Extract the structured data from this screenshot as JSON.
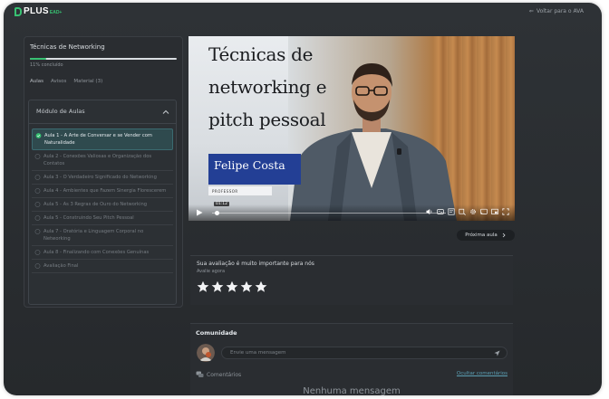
{
  "brand": {
    "name": "PLUS",
    "suffix": "EAD+"
  },
  "header": {
    "back_label": "Voltar para o AVA"
  },
  "sidebar": {
    "course_title": "Técnicas de Networking",
    "progress_percent": 11,
    "progress_label": "11% concluído",
    "tabs": [
      {
        "label": "Aulas",
        "active": true
      },
      {
        "label": "Avisos",
        "active": false
      },
      {
        "label": "Material (3)",
        "active": false
      }
    ],
    "module_title": "Módulo de Aulas",
    "lessons": [
      {
        "label": "Aula 1 - A Arte de Conversar e se Vender com Naturalidade",
        "active": true
      },
      {
        "label": "Aula 2 - Conexões Valiosas e Organização dos Contatos",
        "active": false
      },
      {
        "label": "Aula 3 - O Verdadeiro Significado do Networking",
        "active": false
      },
      {
        "label": "Aula 4 - Ambientes que Fazem Sinergia Florescerem",
        "active": false
      },
      {
        "label": "Aula 5 - As 3 Regras de Ouro do Networking",
        "active": false
      },
      {
        "label": "Aula 5 - Construindo Seu Pitch Pessoal",
        "active": false
      },
      {
        "label": "Aula 7 - Oratória e Linguagem Corporal no Networking",
        "active": false
      },
      {
        "label": "Aula 8 - Finalizando com Conexões Genuínas",
        "active": false
      },
      {
        "label": "Avaliação Final",
        "active": false
      }
    ]
  },
  "video": {
    "title_line1": "Técnicas de",
    "title_line2": "networking e",
    "title_line3": "pitch pessoal",
    "presenter_name": "Felipe Costa",
    "presenter_role": "PROFESSOR",
    "time_tooltip": "01:12",
    "progress_fraction": 0.02
  },
  "next_button": {
    "label": "Próxima aula"
  },
  "rating": {
    "title": "Sua avaliação é muito importante para nós",
    "subtitle": "Avalie agora",
    "max_stars": 5
  },
  "community": {
    "title": "Comunidade",
    "input_placeholder": "Envie uma mensagem",
    "comments_label": "Comentários",
    "hide_comments_label": "Ocultar comentários",
    "empty_label": "Nenhuma mensagem"
  },
  "colors": {
    "accent": "#38c172",
    "active_lesson_bg": "#2f4a4e",
    "link": "#5b9fb4"
  }
}
